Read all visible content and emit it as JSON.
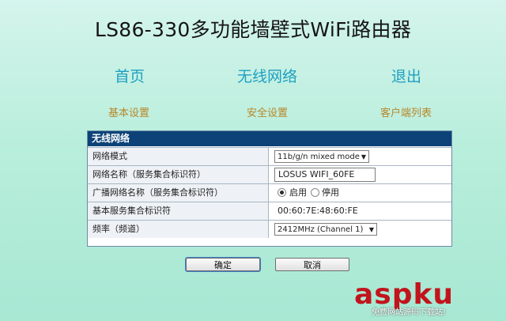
{
  "title": "LS86-330多功能墙壁式WiFi路由器",
  "nav": [
    "首页",
    "无线网络",
    "退出"
  ],
  "subnav": [
    "基本设置",
    "安全设置",
    "客户端列表"
  ],
  "panel": {
    "header": "无线网络",
    "rows": {
      "mode": {
        "label": "网络模式",
        "value": "11b/g/n mixed mode"
      },
      "ssid": {
        "label": "网络名称（服务集合标识符）",
        "value": "LOSUS WIFI_60FE"
      },
      "broadcast": {
        "label": "广播网络名称（服务集合标识符）",
        "on_label": "启用",
        "off_label": "停用",
        "selected": "启用"
      },
      "bssid": {
        "label": "基本服务集合标识符",
        "value": "00:60:7E:48:60:FE"
      },
      "channel": {
        "label": "频率（频道）",
        "value": "2412MHz (Channel 1)"
      }
    }
  },
  "buttons": {
    "confirm": "确定",
    "cancel": "取消"
  },
  "watermark": {
    "main": "aspku",
    "sub": "免费网站源码下载站!"
  },
  "colors": {
    "header_bg": "#0c4277",
    "nav": "#1fa0c0",
    "subnav": "#b88728"
  }
}
